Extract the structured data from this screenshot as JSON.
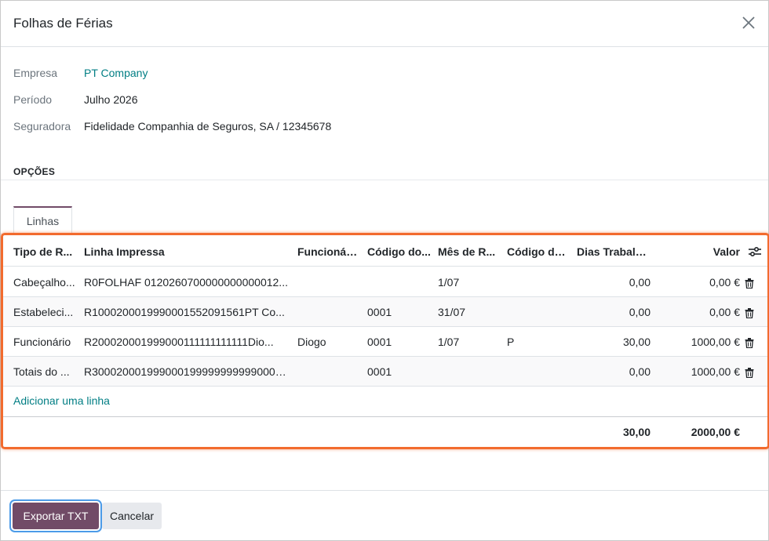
{
  "dialog": {
    "title": "Folhas de Férias"
  },
  "fields": {
    "empresa": {
      "label": "Empresa",
      "value": "PT Company"
    },
    "periodo": {
      "label": "Período",
      "value": "Julho 2026"
    },
    "seguradora": {
      "label": "Seguradora",
      "value": "Fidelidade Companhia de Seguros, SA / 12345678"
    }
  },
  "section": {
    "title": "OPÇÕES"
  },
  "tabs": [
    {
      "label": "Linhas",
      "active": true
    }
  ],
  "table": {
    "columns": [
      "Tipo de R...",
      "Linha Impressa",
      "Funcionário",
      "Código do...",
      "Mês de R...",
      "Código de...",
      "Dias Trabalh...",
      "Valor"
    ],
    "rows": [
      {
        "tipo": "Cabeçalho...",
        "linha": "R0FOLHAF 0120260700000000000012...",
        "funcionario": "",
        "codigo": "",
        "mes": "1/07",
        "codsit": "",
        "dias": "0,00",
        "valor": "0,00 €"
      },
      {
        "tipo": "Estabeleci...",
        "linha": "R1000200019990001552091561PT Co...",
        "funcionario": "",
        "codigo": "0001",
        "mes": "31/07",
        "codsit": "",
        "dias": "0,00",
        "valor": "0,00 €"
      },
      {
        "tipo": "Funcionário",
        "linha": "R200020001999000111111111111Dio...",
        "funcionario": "Diogo",
        "codigo": "0001",
        "mes": "1/07",
        "codsit": "P",
        "dias": "30,00",
        "valor": "1000,00 €"
      },
      {
        "tipo": "Totais do ...",
        "linha": "R3000200019990001999999999990000...",
        "funcionario": "",
        "codigo": "0001",
        "mes": "",
        "codsit": "",
        "dias": "0,00",
        "valor": "1000,00 €"
      }
    ],
    "add_line": "Adicionar uma linha",
    "totals": {
      "dias": "30,00",
      "valor": "2000,00 €"
    }
  },
  "footer": {
    "export_label": "Exportar TXT",
    "cancel_label": "Cancelar"
  },
  "colors": {
    "primary": "#714b67",
    "link": "#017e84",
    "highlight": "#f26b2e"
  }
}
